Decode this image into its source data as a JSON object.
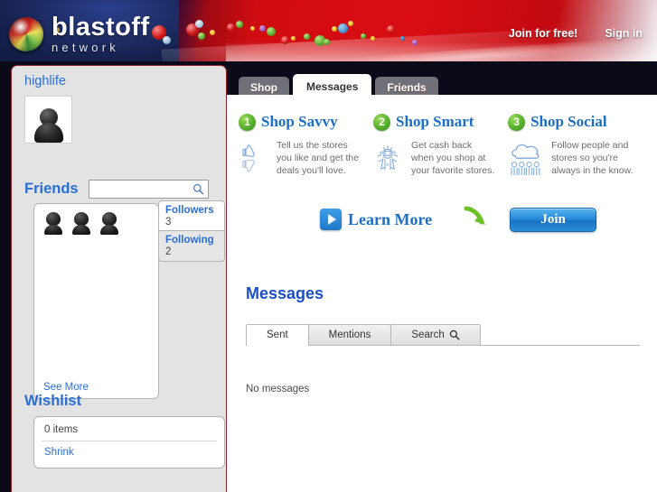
{
  "header": {
    "logo_main": "blastoff",
    "logo_sub": "network",
    "logo_orb_icon": "colorful-sphere-icon",
    "join_free_label": "Join for free!",
    "sign_in_label": "Sign in"
  },
  "sidebar": {
    "username": "highlife",
    "avatar_icon": "user-silhouette-avatar",
    "friends": {
      "heading": "Friends",
      "search_placeholder": "",
      "search_value": "",
      "search_icon": "search-icon",
      "avatar_count": 3,
      "see_more_label": "See More",
      "stats": [
        {
          "label": "Followers",
          "value": "3"
        },
        {
          "label": "Following",
          "value": "2"
        }
      ]
    },
    "wishlist": {
      "heading": "Wishlist",
      "items_label": "0 items",
      "shrink_label": "Shrink"
    }
  },
  "main": {
    "tabs": [
      {
        "label": "Shop",
        "active": false
      },
      {
        "label": "Messages",
        "active": true
      },
      {
        "label": "Friends",
        "active": false
      }
    ],
    "promos": [
      {
        "number": "1",
        "title": "Shop Savvy",
        "icon": "thumbs-up-down-icon",
        "text": "Tell us the stores you like and get the deals you'll love."
      },
      {
        "number": "2",
        "title": "Shop Smart",
        "icon": "person-with-cash-icon",
        "text": "Get cash back when you shop at your favorite stores."
      },
      {
        "number": "3",
        "title": "Shop Social",
        "icon": "cloud-people-icon",
        "text": "Follow people and stores so you're always in the know."
      }
    ],
    "cta": {
      "learn_more_label": "Learn More",
      "play_icon": "play-icon",
      "arrow_icon": "green-curved-arrow-icon",
      "join_label": "Join"
    },
    "messages": {
      "heading": "Messages",
      "tabs": [
        {
          "label": "Sent",
          "active": true,
          "icon": ""
        },
        {
          "label": "Mentions",
          "active": false,
          "icon": ""
        },
        {
          "label": "Search",
          "active": false,
          "icon": "search-icon"
        }
      ],
      "empty_text": "No messages"
    }
  },
  "colors": {
    "brand_red": "#d00d12",
    "brand_blue": "#16224f",
    "link_blue": "#2a6ed6",
    "heading_blue": "#1b50c4",
    "promo_blue": "#1b6fc4",
    "badge_green": "#5cb630"
  }
}
